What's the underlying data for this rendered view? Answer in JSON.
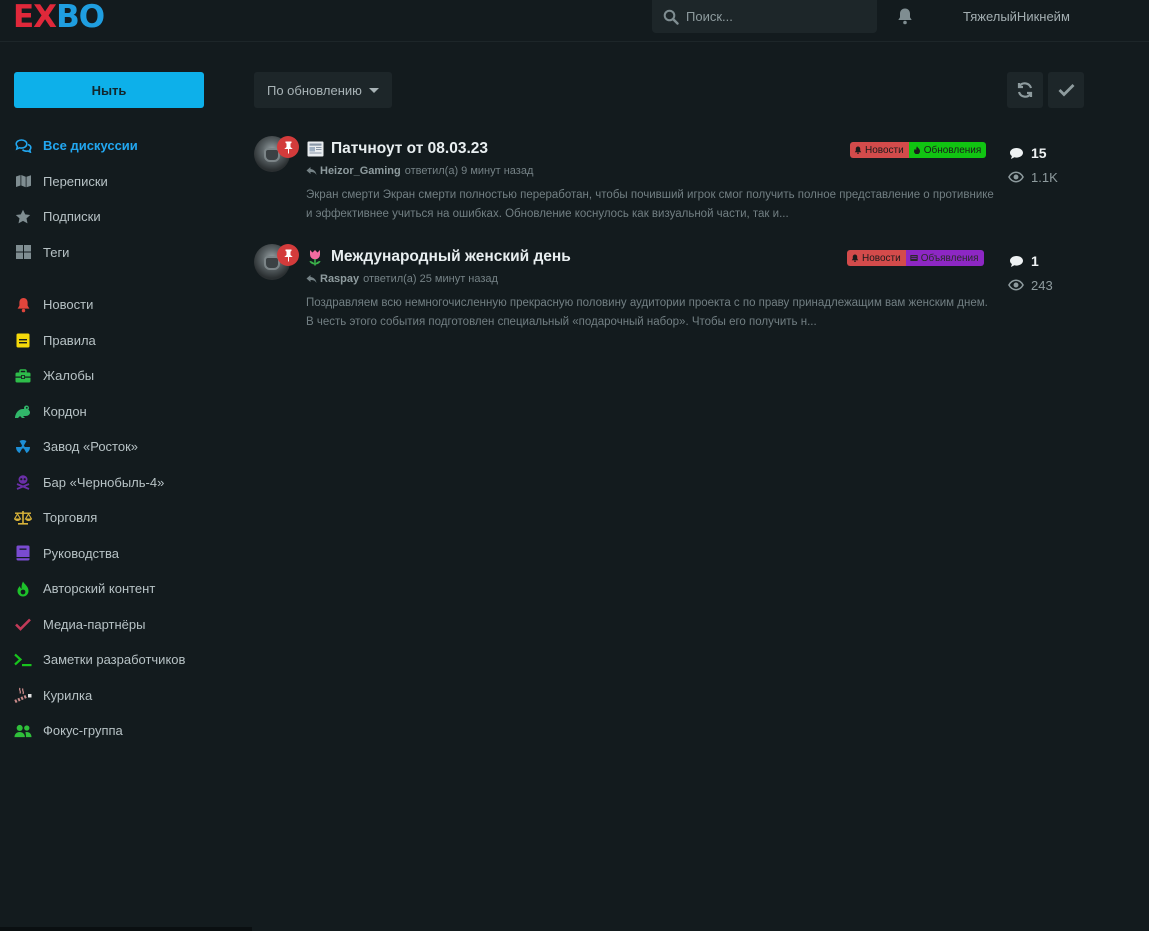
{
  "header": {
    "logo_left": "EX",
    "logo_right": "BO",
    "search_placeholder": "Поиск...",
    "username": "ТяжелыйНикнейм"
  },
  "sidebar": {
    "start_button": "Ныть",
    "nav": [
      {
        "label": "Все дискуссии",
        "icon": "comments-icon",
        "active": true
      },
      {
        "label": "Переписки",
        "icon": "map-icon"
      },
      {
        "label": "Подписки",
        "icon": "star-icon"
      },
      {
        "label": "Теги",
        "icon": "grid-icon"
      }
    ],
    "tags": [
      {
        "label": "Новости",
        "icon": "bell-icon",
        "color": "#e0453c"
      },
      {
        "label": "Правила",
        "icon": "sticky-note-icon",
        "color": "#f5d90a"
      },
      {
        "label": "Жалобы",
        "icon": "toolbox-icon",
        "color": "#2ebd4a"
      },
      {
        "label": "Кордон",
        "icon": "frog-icon",
        "color": "#31b76a"
      },
      {
        "label": "Завод «Росток»",
        "icon": "radiation-icon",
        "color": "#1d8fd6"
      },
      {
        "label": "Бар «Чернобыль-4»",
        "icon": "skull-crossbones-icon",
        "color": "#6a2fa8"
      },
      {
        "label": "Торговля",
        "icon": "balance-scale-icon",
        "color": "#d8b33a"
      },
      {
        "label": "Руководства",
        "icon": "book-icon",
        "color": "#7a4bd1"
      },
      {
        "label": "Авторский контент",
        "icon": "fire-icon",
        "color": "#1dc12a"
      },
      {
        "label": "Медиа-партнёры",
        "icon": "check-icon",
        "color": "#c23a58"
      },
      {
        "label": "Заметки разработчиков",
        "icon": "terminal-icon",
        "color": "#18c41d"
      },
      {
        "label": "Курилка",
        "icon": "smoking-icon",
        "color": "#c98a8a"
      },
      {
        "label": "Фокус-группа",
        "icon": "users-icon",
        "color": "#2fbf3a"
      }
    ]
  },
  "toolbar": {
    "sort_label": "По обновлению"
  },
  "discussions": [
    {
      "title": "Патчноут от 08.03.23",
      "emoji": "newspaper",
      "user": "Heizor_Gaming",
      "action": "ответил(а) 9 минут назад",
      "excerpt": "Экран смерти Экран смерти полностью переработан, чтобы почивший игрок смог получить полное представление о противнике и эффективнее учиться на ошибках. Обновление коснулось как визуальной части, так и...",
      "tags": [
        "Новости",
        "Обновления"
      ],
      "comments": "15",
      "views": "1.1K"
    },
    {
      "title": "Международный женский день",
      "emoji": "tulip",
      "user": "Raspay",
      "action": "ответил(а) 25 минут назад",
      "excerpt": "Поздравляем всю немногочисленную прекрасную половину аудитории проекта с по праву принадлежащим вам женским днем. В честь этого события подготовлен специальный «подарочный набор». Чтобы его получить н...",
      "tags": [
        "Новости",
        "Объявления"
      ],
      "comments": "1",
      "views": "243"
    }
  ]
}
